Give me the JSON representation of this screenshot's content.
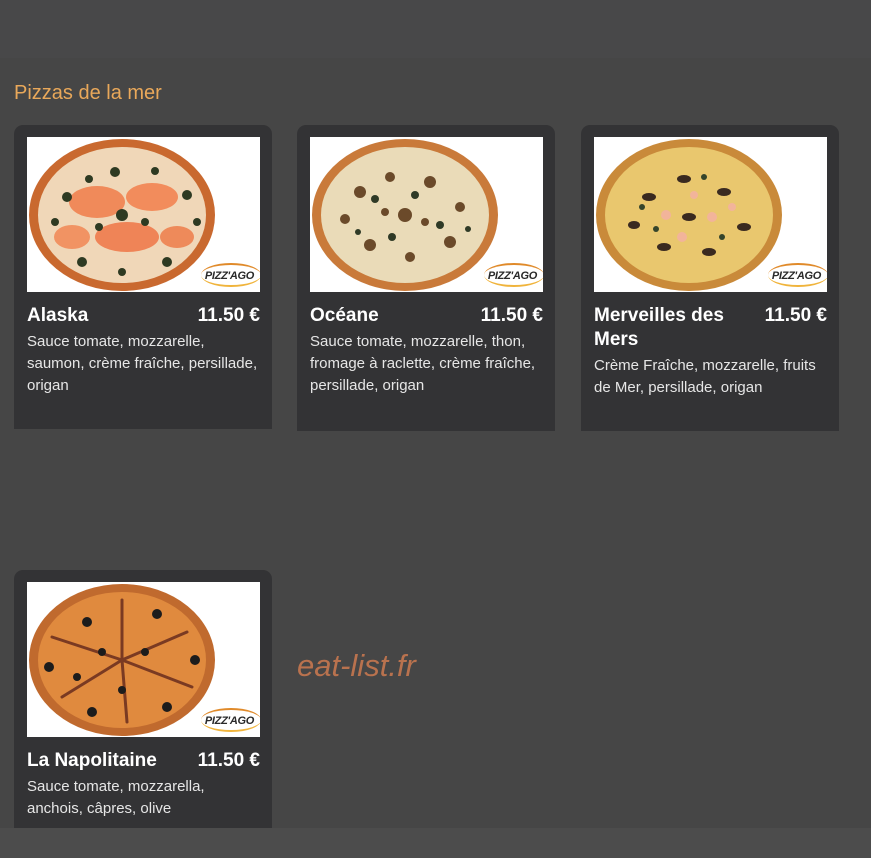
{
  "section": {
    "title": "Pizzas de la mer"
  },
  "pizzas": [
    {
      "name": "Alaska",
      "price": "11.50 €",
      "description": "Sauce tomate, mozzarelle, saumon, crème fraîche, persillade, origan",
      "image_icon": "pizza-alaska-photo",
      "brand": "PIZZ'AGO"
    },
    {
      "name": "Océane",
      "price": "11.50 €",
      "description": "Sauce tomate, mozzarelle, thon, fromage à raclette, crème fraîche, persillade, origan",
      "image_icon": "pizza-oceane-photo",
      "brand": "PIZZ'AGO"
    },
    {
      "name": "Merveilles des Mers",
      "price": "11.50 €",
      "description": "Crème Fraîche, mozzarelle, fruits de Mer, persillade, origan",
      "image_icon": "pizza-merveilles-photo",
      "brand": "PIZZ'AGO"
    },
    {
      "name": "La Napolitaine",
      "price": "11.50 €",
      "description": "Sauce tomate, mozzarella, anchois, câpres, olive",
      "image_icon": "pizza-napolitaine-photo",
      "brand": "PIZZ'AGO"
    }
  ],
  "watermark": "eat-list.fr",
  "colors": {
    "background": "#464646",
    "card": "#333335",
    "section_title": "#e9a85a",
    "watermark": "#b9724e"
  }
}
